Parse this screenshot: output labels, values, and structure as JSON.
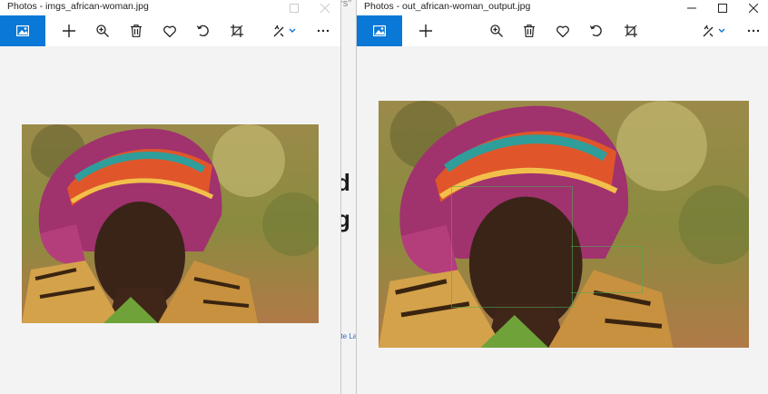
{
  "left_window": {
    "title": "Photos - imgs_african-woman.jpg"
  },
  "right_window": {
    "title": "Photos - out_african-woman_output.jpg"
  },
  "background": {
    "top_text": "ers\"",
    "big_char_1": "d",
    "big_char_2": "g i",
    "link_text": "ate La"
  },
  "toolbar_icons": [
    "view-image-icon",
    "add-icon",
    "zoom-in-icon",
    "delete-icon",
    "favorite-icon",
    "rotate-icon",
    "crop-icon",
    "edit-icon",
    "more-icon"
  ],
  "colors": {
    "accent": "#0a78d7",
    "window_bg": "#f3f3f3",
    "detection_box": "#4caf50"
  }
}
